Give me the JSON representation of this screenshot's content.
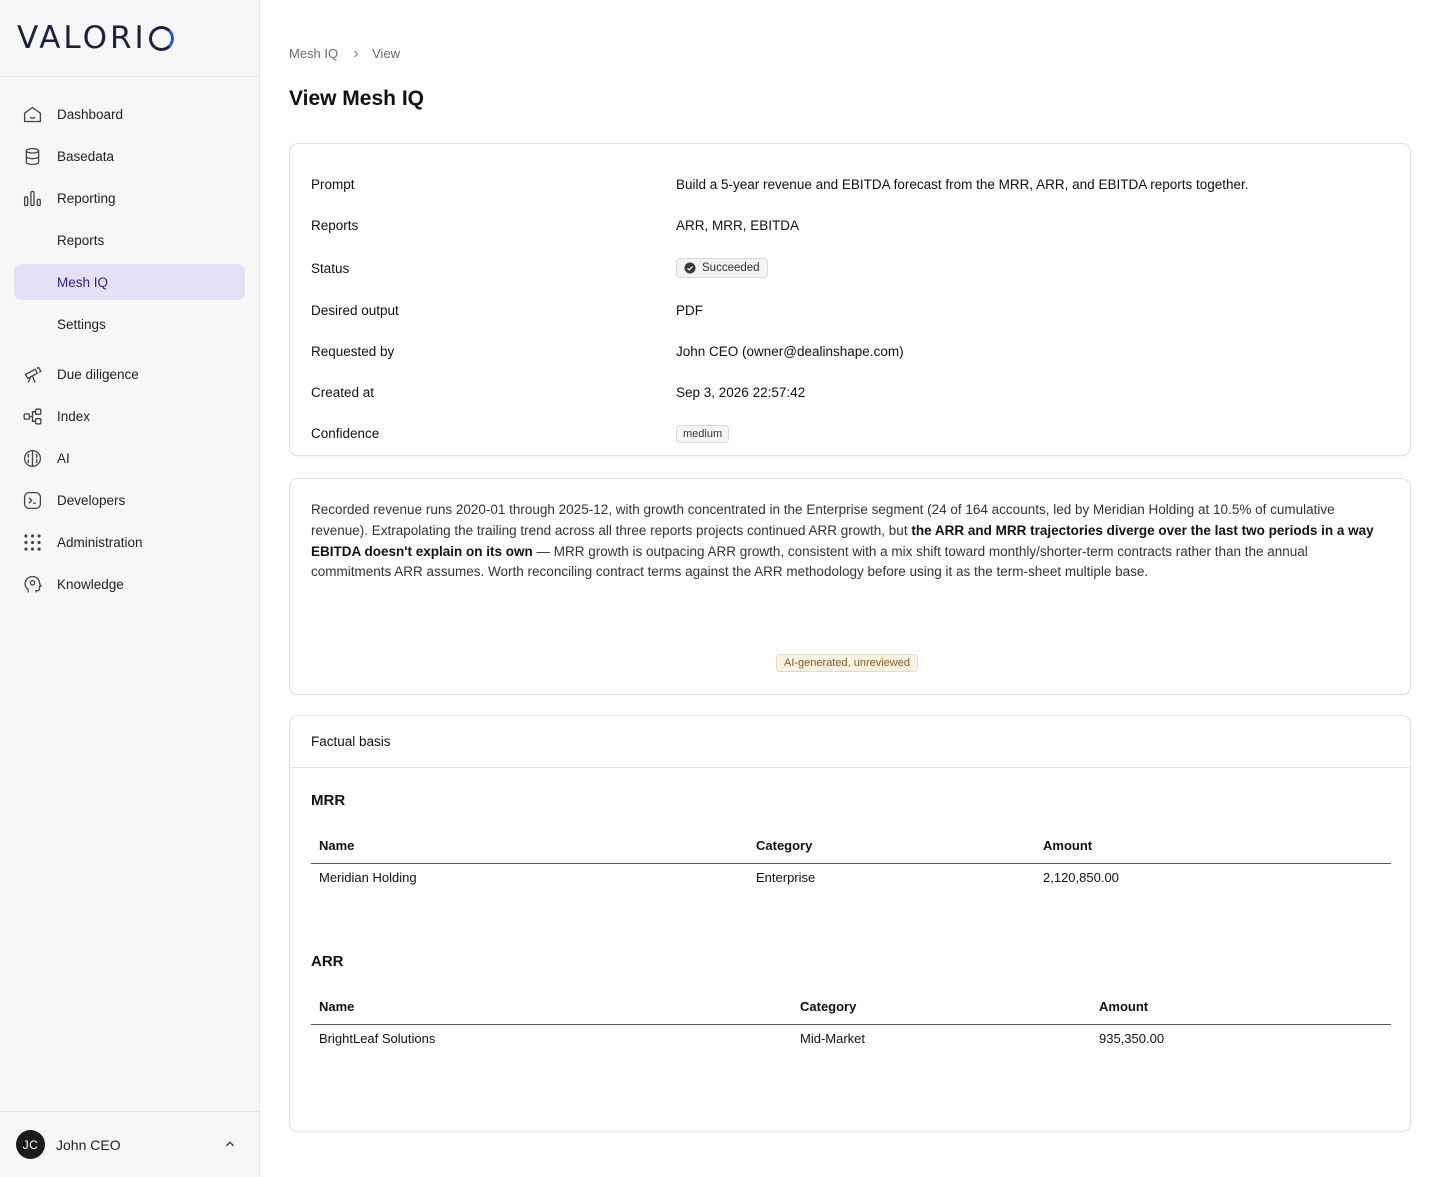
{
  "brand": {
    "logo_text": "VALORI"
  },
  "sidebar": {
    "items": [
      {
        "label": "Dashboard",
        "icon": "home-icon"
      },
      {
        "label": "Basedata",
        "icon": "database-icon"
      },
      {
        "label": "Reporting",
        "icon": "bar-chart-icon"
      },
      {
        "label": "Reports",
        "icon": ""
      },
      {
        "label": "Mesh IQ",
        "icon": ""
      },
      {
        "label": "Settings",
        "icon": ""
      },
      {
        "label": "Due diligence",
        "icon": "telescope-icon"
      },
      {
        "label": "Index",
        "icon": "graph-nodes-icon"
      },
      {
        "label": "AI",
        "icon": "brain-icon"
      },
      {
        "label": "Developers",
        "icon": "terminal-icon"
      },
      {
        "label": "Administration",
        "icon": "grid-dots-icon"
      },
      {
        "label": "Knowledge",
        "icon": "head-icon"
      }
    ],
    "active": "Mesh IQ",
    "user": {
      "initials": "JC",
      "name": "John CEO"
    }
  },
  "breadcrumb": {
    "parent": "Mesh IQ",
    "current": "View"
  },
  "page": {
    "title": "View Mesh IQ"
  },
  "details": {
    "prompt_label": "Prompt",
    "prompt_value": "Build a 5-year revenue and EBITDA forecast from the MRR, ARR, and EBITDA reports together.",
    "reports_label": "Reports",
    "reports_value": "ARR, MRR, EBITDA",
    "status_label": "Status",
    "status_value": "Succeeded",
    "output_label": "Desired output",
    "output_value": "PDF",
    "requested_label": "Requested by",
    "requested_value": "John CEO (owner@dealinshape.com)",
    "created_label": "Created at",
    "created_value": "Sep 3, 2026 22:57:42",
    "confidence_label": "Confidence",
    "confidence_value": "medium"
  },
  "summary": {
    "text_1": "Recorded revenue runs 2020-01 through 2025-12, with growth concentrated in the Enterprise segment (24 of 164 accounts, led by Meridian Holding at 10.5% of cumulative revenue). Extrapolating the trailing trend across all three reports projects continued ARR growth, but ",
    "text_bold": "the ARR and MRR trajectories diverge over the last two periods in a way EBITDA doesn't explain on its own",
    "text_2": " — MRR growth is outpacing ARR growth, consistent with a mix shift toward monthly/shorter-term contracts rather than the annual commitments ARR assumes. Worth reconciling contract terms against the ARR methodology before using it as the term-sheet multiple base.",
    "ai_badge": "AI-generated, unreviewed"
  },
  "basis": {
    "title": "Factual basis",
    "sections": [
      {
        "title": "MRR",
        "headers": [
          "Name",
          "Category",
          "Amount"
        ],
        "rows": [
          [
            "Meridian Holding",
            "Enterprise",
            "2,120,850.00"
          ]
        ]
      },
      {
        "title": "ARR",
        "headers": [
          "Name",
          "Category",
          "Amount"
        ],
        "rows": [
          [
            "BrightLeaf Solutions",
            "Mid-Market",
            "935,350.00"
          ]
        ]
      }
    ]
  },
  "colors": {
    "accent": "#2a2490",
    "active_bg": "#e4e1f6",
    "logo_blue": "#2458e6",
    "ai_badge": "#8a5a22"
  }
}
